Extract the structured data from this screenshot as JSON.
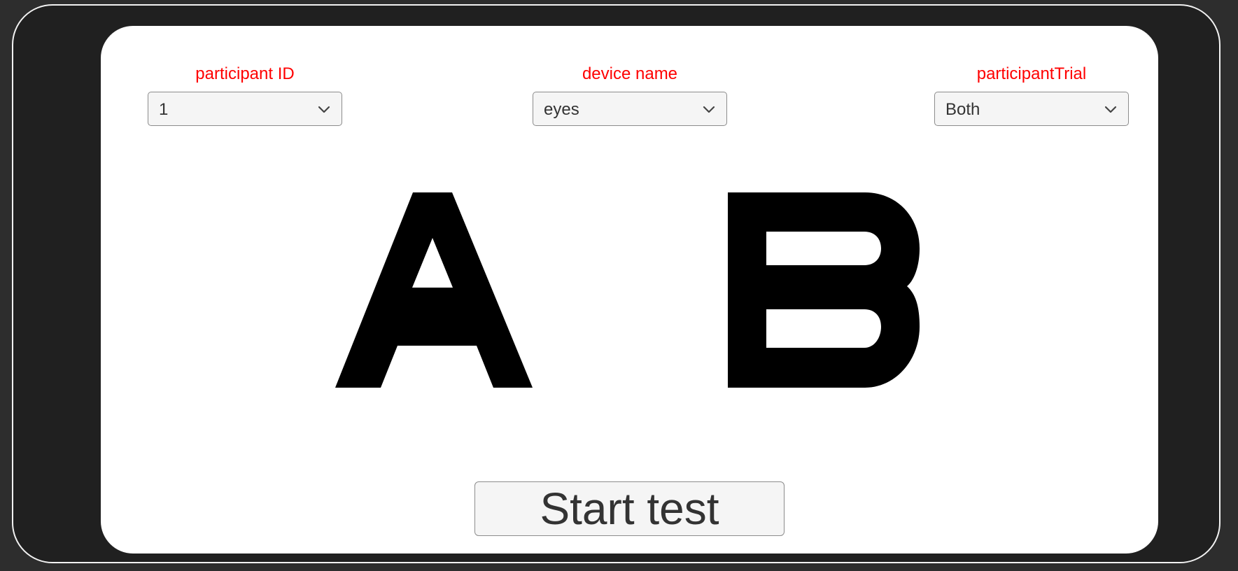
{
  "form": {
    "participant_id": {
      "label": "participant ID",
      "value": "1"
    },
    "device_name": {
      "label": "device name",
      "value": "eyes"
    },
    "participant_trial": {
      "label": "participantTrial",
      "value": "Both"
    }
  },
  "stimulus": {
    "letter_left": "A",
    "letter_right": "B"
  },
  "actions": {
    "start_label": "Start test"
  },
  "colors": {
    "label_red": "#ff0000",
    "frame_dark": "#202020",
    "screen_white": "#ffffff",
    "letter_black": "#000000"
  },
  "icons": {
    "dropdown": "chevron-down-icon"
  }
}
